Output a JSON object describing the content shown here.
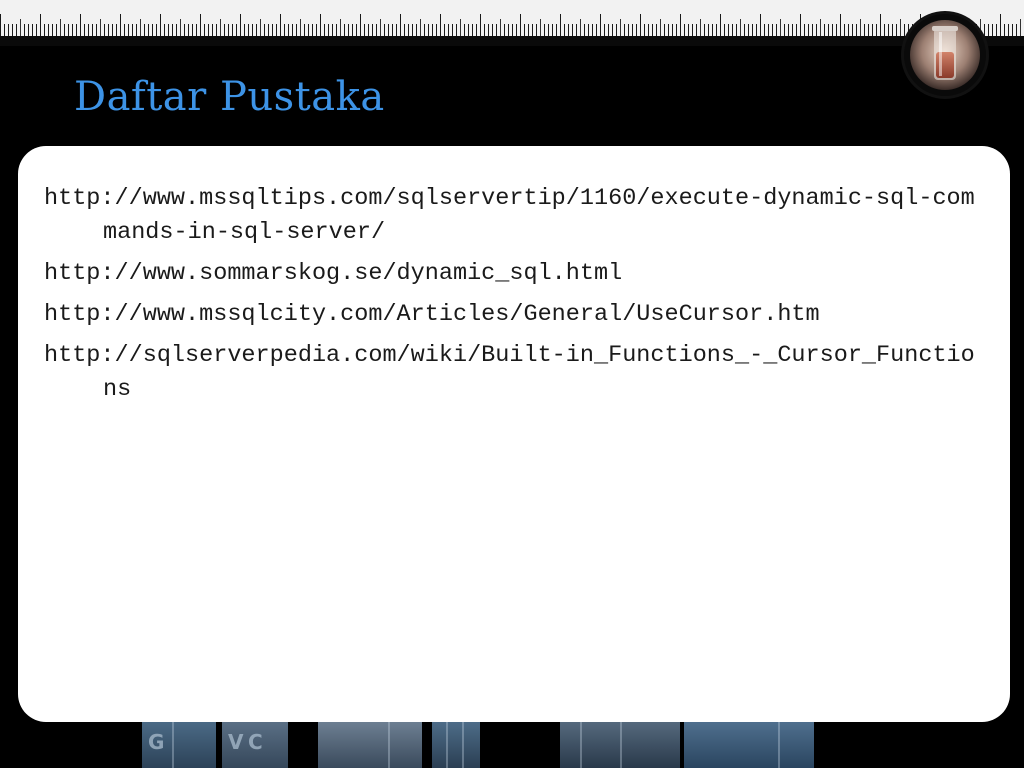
{
  "slide": {
    "title": "Daftar Pustaka",
    "references": [
      "http://www.mssqltips.com/sqlservertip/1160/execute-dynamic-sql-commands-in-sql-server/",
      "http://www.sommarskog.se/dynamic_sql.html",
      "http://www.mssqlcity.com/Articles/General/UseCursor.htm",
      "http://sqlserverpedia.com/wiki/Built-in_Functions_-_Cursor_Functions"
    ]
  },
  "theme": {
    "background": "#000000",
    "title_color": "#3d93e6",
    "panel_color": "#ffffff",
    "text_color": "#1a1a1a"
  },
  "icons": {
    "logo": "test-tube-beaker-icon"
  }
}
